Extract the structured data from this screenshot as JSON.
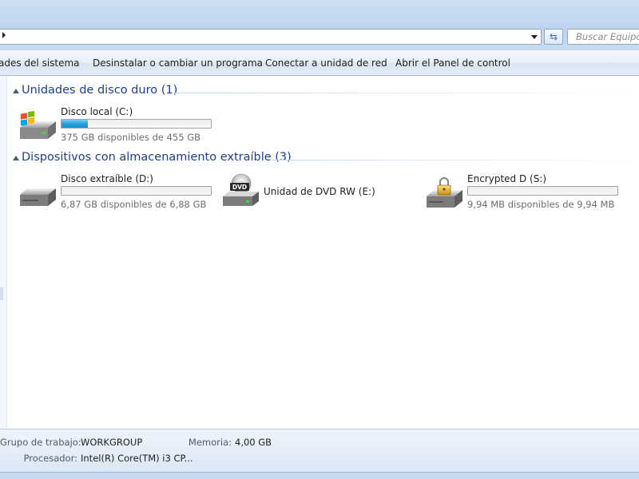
{
  "search": {
    "placeholder": "Buscar Equipo"
  },
  "commands": {
    "system_properties": "ades del sistema",
    "uninstall": "Desinstalar o cambiar un programa",
    "map_network": "Conectar a unidad de red",
    "control_panel": "Abrir el Panel de control"
  },
  "groups": {
    "hard_drives": {
      "title": "Unidades de disco duro (1)",
      "drives": [
        {
          "name": "Disco local (C:)",
          "free_text": "375 GB disponibles de 455 GB",
          "used_fraction": 0.176,
          "icon": "windows-drive-icon"
        }
      ]
    },
    "removable": {
      "title": "Dispositivos con almacenamiento extraíble (3)",
      "drives": [
        {
          "name": "Disco extraíble (D:)",
          "free_text": "6,87 GB disponibles de 6,88 GB",
          "used_fraction": 0.0015,
          "icon": "removable-drive-icon"
        },
        {
          "name": "Unidad de DVD RW (E:)",
          "icon": "dvd-drive-icon",
          "dvd_label": "DVD"
        },
        {
          "name": "Encrypted D (S:)",
          "free_text": "9,94 MB disponibles de 9,94 MB",
          "used_fraction": 0.0,
          "icon": "encrypted-drive-icon"
        }
      ]
    }
  },
  "details": {
    "workgroup_label": "Grupo de trabajo:",
    "workgroup_value": "WORKGROUP",
    "memory_label": "Memoria:",
    "memory_value": "4,00 GB",
    "processor_label": "Procesador:",
    "processor_value": "Intel(R) Core(TM) i3 CP..."
  },
  "colors": {
    "accent_title": "#1e3f8e",
    "bar_fill": "#26a0da"
  }
}
